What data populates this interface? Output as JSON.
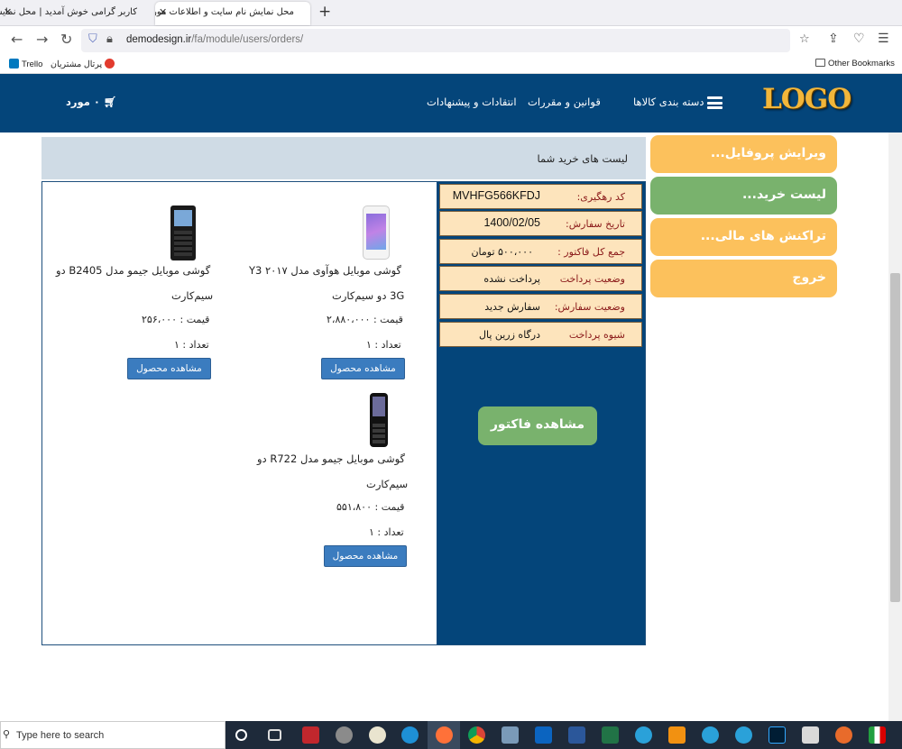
{
  "browser": {
    "tabs": [
      {
        "title": "کاربر گرامی خوش آمدید | محل نمایش نا"
      },
      {
        "title": "محل نمایش نام سایت و اطلاعات مورد"
      }
    ],
    "address": {
      "host": "demodesign.ir",
      "path": "/fa/module/users/orders/"
    },
    "bookmarks": {
      "trello": "Trello",
      "portal": "پرتال مشتریان",
      "other": "Other Bookmarks"
    }
  },
  "header": {
    "logo": "LOGO",
    "category_menu": "دسته بندی کالاها",
    "links": [
      "قوانین و مقررات",
      "انتقادات و پیشنهادات"
    ],
    "cart": "۰ مورد"
  },
  "sidebar": {
    "items": [
      {
        "label": "ویرایش پروفایل..."
      },
      {
        "label": "لیست خرید..."
      },
      {
        "label": "تراکنش های مالی..."
      },
      {
        "label": "خروج"
      }
    ]
  },
  "orders": {
    "title": "لیست های خرید شما",
    "info": [
      {
        "label": "کد رهگیری:",
        "value": "MVHFG566KFDJ"
      },
      {
        "label": "تاریخ سفارش:",
        "value": "1400/02/05"
      },
      {
        "label": "جمع کل فاکتور :",
        "value": "۵۰۰،۰۰۰ تومان"
      },
      {
        "label": "وضعیت پرداخت",
        "value": "پرداخت نشده"
      },
      {
        "label": "وضعیت سفارش:",
        "value": "سفارش جدید"
      },
      {
        "label": "شیوه پرداخت",
        "value": "درگاه زرین پال"
      }
    ],
    "invoice_button": "مشاهده فاکتور",
    "products": [
      {
        "name_line1": "گوشی موبایل هوآوی مدل ۲۰۱۷ Y3",
        "name_line2": "3G دو سیم‌کارت",
        "price": "قیمت : ۲،۸۸۰،۰۰۰",
        "qty": "تعداد : ۱",
        "button": "مشاهده محصول"
      },
      {
        "name_line1": "گوشی موبایل جیمو مدل B2405 دو",
        "name_line2": "سیم‌کارت",
        "price": "قیمت : ۲۵۶،۰۰۰",
        "qty": "تعداد : ۱",
        "button": "مشاهده محصول"
      },
      {
        "name_line1": "گوشی موبایل جیمو مدل R722 دو",
        "name_line2": "سیم‌کارت",
        "price": "قیمت : ۵۵۱،۸۰۰",
        "qty": "تعداد : ۱",
        "button": "مشاهده محصول"
      }
    ]
  },
  "taskbar": {
    "search_placeholder": "Type here to search"
  },
  "colors": {
    "header": "#04457a",
    "sidebar_orange": "#fcc15c",
    "sidebar_green": "#79b26d",
    "info_row": "#fde4bc",
    "product_button": "#3b7cbf"
  }
}
